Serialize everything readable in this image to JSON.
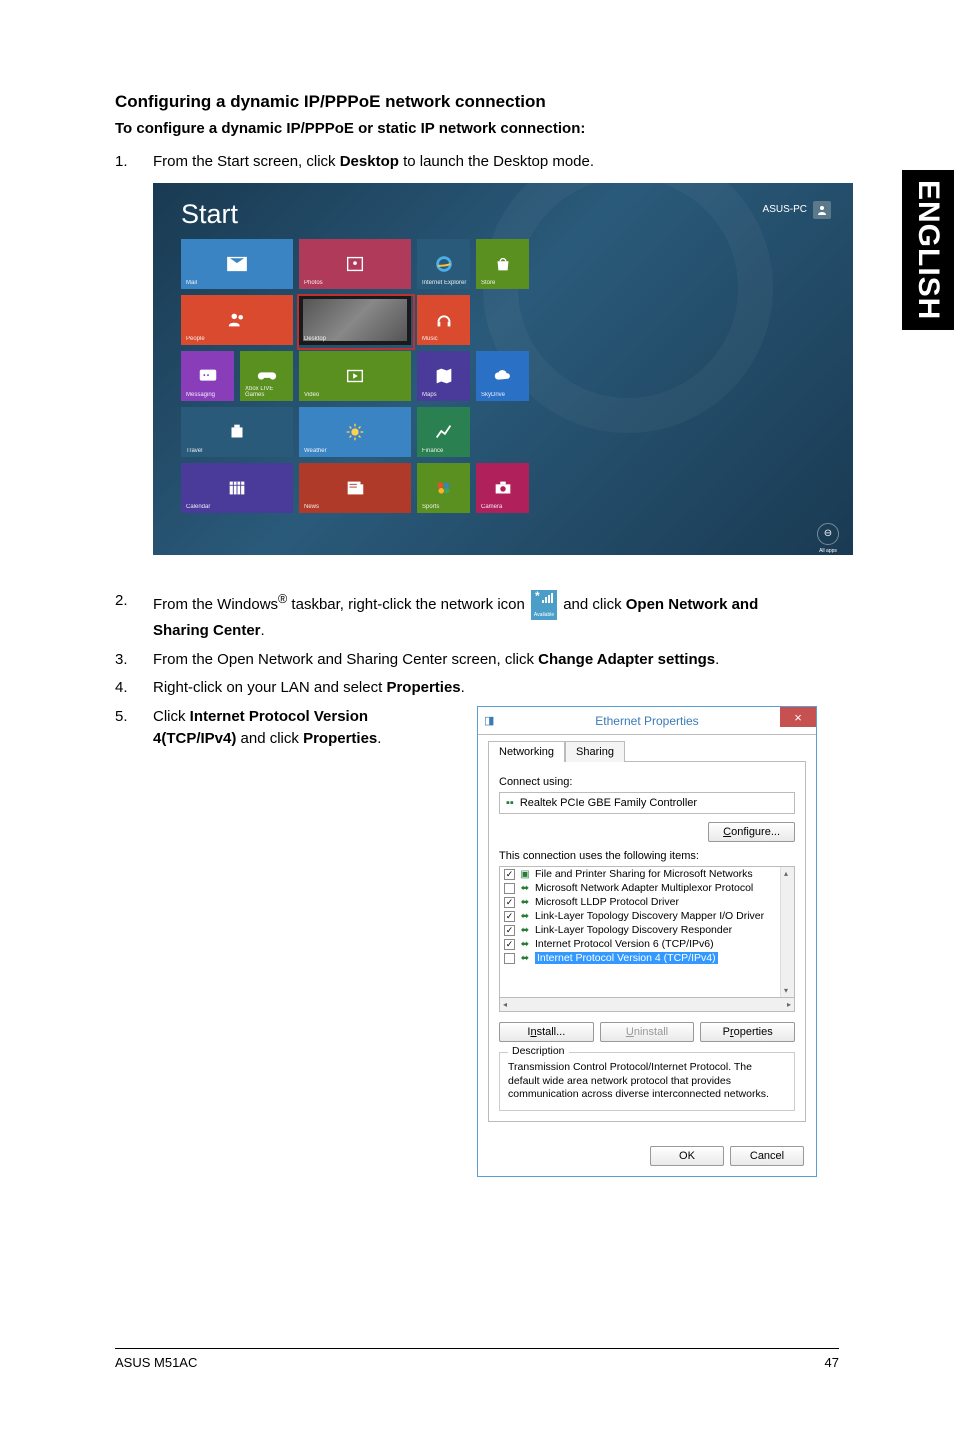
{
  "heading": "Configuring a dynamic IP/PPPoE network connection",
  "sub_heading": "To configure a dynamic IP/PPPoE or static IP network connection:",
  "side_tab": "ENGLISH",
  "steps": [
    {
      "num": "1.",
      "prefix": "From the Start screen, click ",
      "bold": "Desktop",
      "suffix": " to launch the Desktop mode."
    },
    {
      "num": "2.",
      "parts": [
        "From the Windows",
        "®",
        " taskbar, right-click the network icon ",
        " and click ",
        "Open Network and Sharing Center",
        "."
      ]
    },
    {
      "num": "3.",
      "prefix": "From the Open Network and Sharing Center screen, click ",
      "bold": "Change Adapter settings",
      "suffix": "."
    },
    {
      "num": "4.",
      "prefix": "Right-click on your LAN and select ",
      "bold": "Properties",
      "suffix": "."
    },
    {
      "num": "5.",
      "prefix": "Click ",
      "bold": "Internet Protocol Version 4(TCP/IPv4)",
      "mid": " and click ",
      "bold2": "Properties",
      "suffix": "."
    }
  ],
  "start": {
    "title": "Start",
    "user": "ASUS-PC",
    "tiles": {
      "mail": "Mail",
      "photos": "Photos",
      "ie": "Internet Explorer",
      "store": "Store",
      "people": "People",
      "desktop": "Desktop",
      "music": "Music",
      "messaging": "Messaging",
      "games": "Xbox LIVE Games",
      "video": "Video",
      "maps": "Maps",
      "skydrive": "SkyDrive",
      "travel": "Travel",
      "weather": "Weather",
      "finance": "Finance",
      "calendar": "Calendar",
      "news": "News",
      "sports": "Sports",
      "camera": "Camera"
    },
    "all_apps": "All apps"
  },
  "net_icon_label": "Available",
  "eth": {
    "title": "Ethernet Properties",
    "tabs": [
      "Networking",
      "Sharing"
    ],
    "connect_label": "Connect using:",
    "adapter": "Realtek PCIe GBE Family Controller",
    "configure": "Configure...",
    "items_label": "This connection uses the following items:",
    "items": [
      {
        "checked": true,
        "icon": "share",
        "label": "File and Printer Sharing for Microsoft Networks"
      },
      {
        "checked": false,
        "icon": "proto",
        "label": "Microsoft Network Adapter Multiplexor Protocol"
      },
      {
        "checked": true,
        "icon": "proto",
        "label": "Microsoft LLDP Protocol Driver"
      },
      {
        "checked": true,
        "icon": "proto",
        "label": "Link-Layer Topology Discovery Mapper I/O Driver"
      },
      {
        "checked": true,
        "icon": "proto",
        "label": "Link-Layer Topology Discovery Responder"
      },
      {
        "checked": true,
        "icon": "proto",
        "label": "Internet Protocol Version 6 (TCP/IPv6)"
      },
      {
        "checked": true,
        "icon": "proto",
        "label": "Internet Protocol Version 4 (TCP/IPv4)",
        "selected": true
      }
    ],
    "install": "Install...",
    "uninstall": "Uninstall",
    "properties": "Properties",
    "desc_title": "Description",
    "description": "Transmission Control Protocol/Internet Protocol. The default wide area network protocol that provides communication across diverse interconnected networks.",
    "ok": "OK",
    "cancel": "Cancel"
  },
  "footer": {
    "left": "ASUS M51AC",
    "right": "47"
  }
}
